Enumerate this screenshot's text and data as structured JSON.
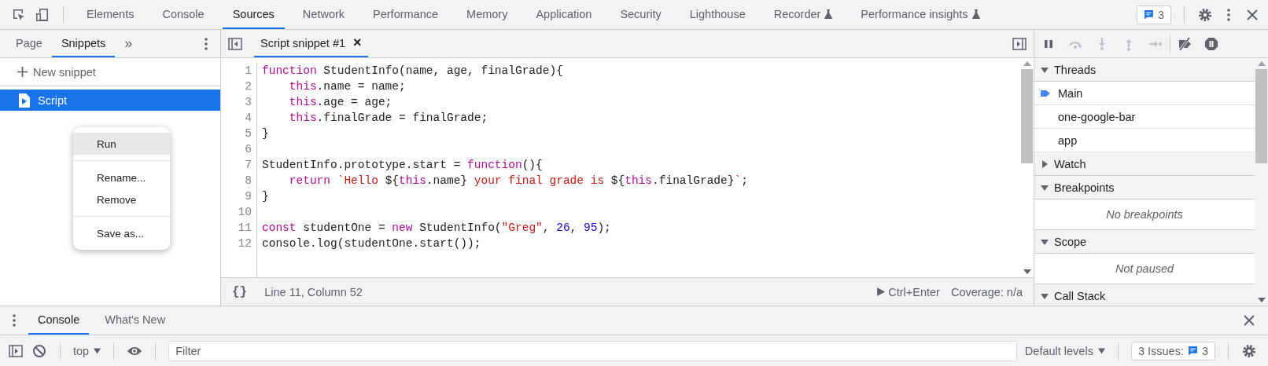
{
  "main_tabs": [
    {
      "label": "Elements",
      "selected": false,
      "experimental": false
    },
    {
      "label": "Console",
      "selected": false,
      "experimental": false
    },
    {
      "label": "Sources",
      "selected": true,
      "experimental": false
    },
    {
      "label": "Network",
      "selected": false,
      "experimental": false
    },
    {
      "label": "Performance",
      "selected": false,
      "experimental": false
    },
    {
      "label": "Memory",
      "selected": false,
      "experimental": false
    },
    {
      "label": "Application",
      "selected": false,
      "experimental": false
    },
    {
      "label": "Security",
      "selected": false,
      "experimental": false
    },
    {
      "label": "Lighthouse",
      "selected": false,
      "experimental": false
    },
    {
      "label": "Recorder",
      "selected": false,
      "experimental": true
    },
    {
      "label": "Performance insights",
      "selected": false,
      "experimental": true
    }
  ],
  "issues_badge": "3",
  "navigator": {
    "tabs": [
      {
        "label": "Page",
        "selected": false
      },
      {
        "label": "Snippets",
        "selected": true
      }
    ],
    "more": "»",
    "new_snippet": "New snippet",
    "snippets": [
      {
        "label": "Script",
        "selected": true
      }
    ]
  },
  "context_menu": {
    "groups": [
      [
        {
          "label": "Run",
          "selected": true
        }
      ],
      [
        {
          "label": "Rename...",
          "selected": false
        },
        {
          "label": "Remove",
          "selected": false
        }
      ],
      [
        {
          "label": "Save as...",
          "selected": false
        }
      ]
    ]
  },
  "editor": {
    "tabs": [
      {
        "label": "Script snippet #1",
        "selected": true
      }
    ],
    "close": "×",
    "lines": [
      {
        "number": "1",
        "tokens": [
          {
            "kind": "keyword",
            "text": "function"
          },
          {
            "kind": "plain",
            "text": " StudentInfo(name, age, finalGrade){"
          }
        ]
      },
      {
        "number": "2",
        "indent": true,
        "tokens": [
          {
            "kind": "keyword",
            "text": "this"
          },
          {
            "kind": "plain",
            "text": ".name = name;"
          }
        ]
      },
      {
        "number": "3",
        "indent": true,
        "tokens": [
          {
            "kind": "keyword",
            "text": "this"
          },
          {
            "kind": "plain",
            "text": ".age = age;"
          }
        ]
      },
      {
        "number": "4",
        "indent": true,
        "tokens": [
          {
            "kind": "keyword",
            "text": "this"
          },
          {
            "kind": "plain",
            "text": ".finalGrade = finalGrade;"
          }
        ]
      },
      {
        "number": "5",
        "tokens": [
          {
            "kind": "plain",
            "text": "}"
          }
        ]
      },
      {
        "number": "6"
      },
      {
        "number": "7",
        "tokens": [
          {
            "kind": "plain",
            "text": "StudentInfo.prototype.start = "
          },
          {
            "kind": "keyword",
            "text": "function"
          },
          {
            "kind": "plain",
            "text": "(){"
          }
        ]
      },
      {
        "number": "8",
        "indent": true,
        "tokens": [
          {
            "kind": "keyword",
            "text": "return"
          },
          {
            "kind": "string",
            "text": " `Hello "
          },
          {
            "kind": "plain",
            "text": "${"
          },
          {
            "kind": "keyword",
            "text": "this"
          },
          {
            "kind": "plain",
            "text": ".name}"
          },
          {
            "kind": "string",
            "text": " your final grade is "
          },
          {
            "kind": "plain",
            "text": "${"
          },
          {
            "kind": "keyword",
            "text": "this"
          },
          {
            "kind": "plain",
            "text": ".finalGrade}"
          },
          {
            "kind": "string",
            "text": "`"
          },
          {
            "kind": "plain",
            "text": ";"
          }
        ]
      },
      {
        "number": "9",
        "tokens": [
          {
            "kind": "plain",
            "text": "}"
          }
        ]
      },
      {
        "number": "10"
      },
      {
        "number": "11",
        "tokens": [
          {
            "kind": "keyword",
            "text": "const"
          },
          {
            "kind": "plain",
            "text": " studentOne = "
          },
          {
            "kind": "keyword",
            "text": "new"
          },
          {
            "kind": "plain",
            "text": " StudentInfo("
          },
          {
            "kind": "string",
            "text": "\"Greg\""
          },
          {
            "kind": "plain",
            "text": ", "
          },
          {
            "kind": "number",
            "text": "26"
          },
          {
            "kind": "plain",
            "text": ", "
          },
          {
            "kind": "number",
            "text": "95"
          },
          {
            "kind": "plain",
            "text": ");"
          }
        ]
      },
      {
        "number": "12",
        "tokens": [
          {
            "kind": "plain",
            "text": "console.log(studentOne.start());"
          }
        ]
      }
    ],
    "format_button": "{}",
    "cursor_position": "Line 11, Column 52",
    "run_shortcut": "Ctrl+Enter",
    "coverage": "Coverage: n/a"
  },
  "debugger": {
    "buttons": [
      {
        "kind": "pause",
        "disabled": false
      },
      {
        "kind": "step-over",
        "disabled": true
      },
      {
        "kind": "step-into",
        "disabled": true
      },
      {
        "kind": "step-out",
        "disabled": true
      },
      {
        "kind": "step",
        "disabled": true
      },
      {
        "kind": "deactivate",
        "disabled": false
      },
      {
        "kind": "pause-exceptions",
        "disabled": false
      }
    ],
    "sections": [
      {
        "title": "Threads",
        "expanded": true,
        "threads": [
          {
            "label": "Main",
            "selected": true
          },
          {
            "label": "one-google-bar",
            "selected": false
          },
          {
            "label": "app",
            "selected": false
          }
        ]
      },
      {
        "title": "Watch",
        "expanded": false
      },
      {
        "title": "Breakpoints",
        "expanded": true,
        "message": "No breakpoints"
      },
      {
        "title": "Scope",
        "expanded": true,
        "message": "Not paused"
      },
      {
        "title": "Call Stack",
        "expanded": true
      }
    ]
  },
  "drawer": {
    "tabs": [
      {
        "label": "Console",
        "selected": true
      },
      {
        "label": "What's New",
        "selected": false
      }
    ],
    "context": "top",
    "filter_placeholder": "Filter",
    "levels": "Default levels",
    "issues_label": "3 Issues:",
    "issues_count": "3"
  }
}
